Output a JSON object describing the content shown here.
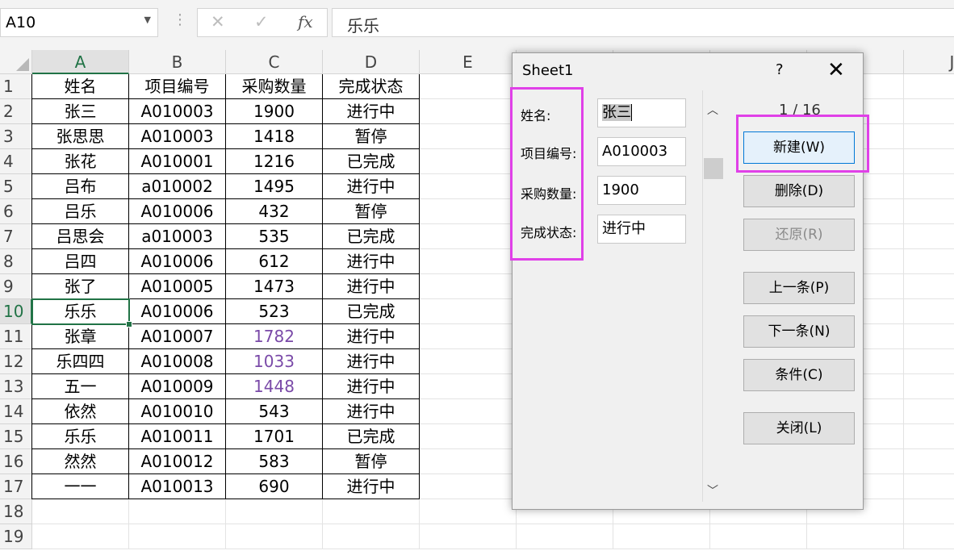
{
  "formula_bar": {
    "name_box": "A10",
    "dropdown_icon": "chevron-down-icon",
    "cancel_icon": "✕",
    "enter_icon": "✓",
    "fx_label": "fx",
    "content": "乐乐"
  },
  "sheet": {
    "columns": [
      "A",
      "B",
      "C",
      "D",
      "E",
      "",
      "",
      "",
      "",
      "J"
    ],
    "rows": [
      "1",
      "2",
      "3",
      "4",
      "5",
      "6",
      "7",
      "8",
      "9",
      "10",
      "11",
      "12",
      "13",
      "14",
      "15",
      "16",
      "17",
      "18",
      "19"
    ],
    "table": [
      [
        "姓名",
        "项目编号",
        "采购数量",
        "完成状态"
      ],
      [
        "张三",
        "A010003",
        "1900",
        "进行中"
      ],
      [
        "张思思",
        "A010003",
        "1418",
        "暂停"
      ],
      [
        "张花",
        "A010001",
        "1216",
        "已完成"
      ],
      [
        "吕布",
        "a010002",
        "1495",
        "进行中"
      ],
      [
        "吕乐",
        "A010006",
        "432",
        "暂停"
      ],
      [
        "吕思会",
        "a010003",
        "535",
        "已完成"
      ],
      [
        "吕四",
        "A010006",
        "612",
        "进行中"
      ],
      [
        "张了",
        "A010005",
        "1473",
        "进行中"
      ],
      [
        "乐乐",
        "A010006",
        "523",
        "已完成"
      ],
      [
        "张章",
        "A010007",
        "1782",
        "进行中"
      ],
      [
        "乐四四",
        "A010008",
        "1033",
        "进行中"
      ],
      [
        "五一",
        "A010009",
        "1448",
        "进行中"
      ],
      [
        "依然",
        "A010010",
        "543",
        "进行中"
      ],
      [
        "乐乐",
        "A010011",
        "1701",
        "已完成"
      ],
      [
        "然然",
        "A010012",
        "583",
        "暂停"
      ],
      [
        "一一",
        "A010013",
        "690",
        "进行中"
      ]
    ],
    "selected_cell": "A10",
    "highlight_color": "#7a4aa8"
  },
  "dialog": {
    "title": "Sheet1",
    "help": "?",
    "close_icon": "close-icon",
    "fields": [
      {
        "label": "姓名:",
        "value": "张三"
      },
      {
        "label": "项目编号:",
        "value": "A010003"
      },
      {
        "label": "采购数量:",
        "value": "1900"
      },
      {
        "label": "完成状态:",
        "value": "进行中"
      }
    ],
    "record_counter": "1 / 16",
    "buttons": {
      "new": "新建(W)",
      "delete": "删除(D)",
      "restore": "还原(R)",
      "prev": "上一条(P)",
      "next": "下一条(N)",
      "criteria": "条件(C)",
      "close": "关闭(L)"
    },
    "annotation_color": "#e040e8"
  }
}
